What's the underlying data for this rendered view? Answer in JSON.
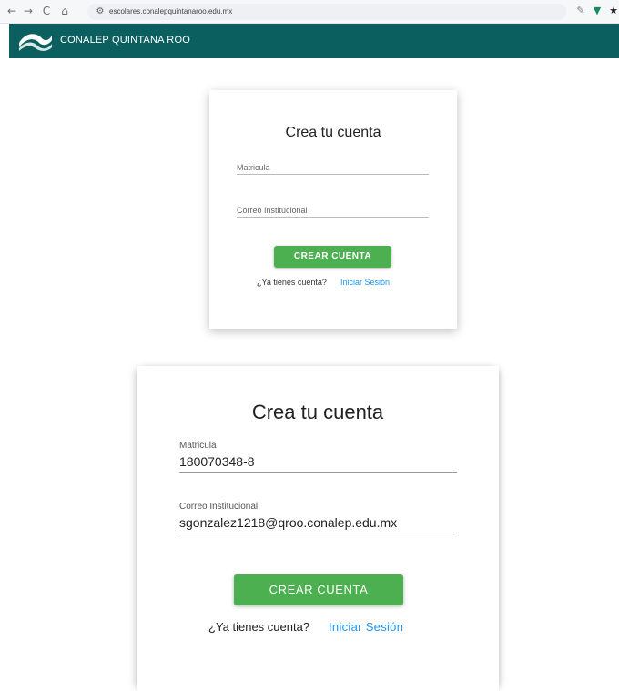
{
  "browser": {
    "back_icon": "←",
    "forward_icon": "→",
    "reload_icon": "C",
    "home_icon": "⌂",
    "site_icon": "⚙",
    "url": "escolares.conalepquintanaroo.edu.mx",
    "ext1_icon": "✎",
    "ext2_icon": "▼",
    "ext3_icon": "★"
  },
  "header": {
    "brand": "CONALEP QUINTANA ROO",
    "color": "#0b5f5f"
  },
  "signup_small": {
    "title": "Crea tu cuenta",
    "matricula_label": "Matricula",
    "correo_label": "Correo Institucional",
    "button_label": "CREAR CUENTA",
    "question": "¿Ya tienes cuenta?",
    "login_link": "Iniciar Sesión"
  },
  "signup_zoom": {
    "title": "Crea tu cuenta",
    "matricula_label": "Matricula",
    "matricula_value": "180070348-8",
    "correo_label": "Correo Institucional",
    "correo_value": "sgonzalez1218@qroo.conalep.edu.mx",
    "button_label": "CREAR CUENTA",
    "question": "¿Ya tienes cuenta?",
    "login_link": "Iniciar Sesión"
  },
  "colors": {
    "button": "#4caf50",
    "link": "#2196f3"
  }
}
